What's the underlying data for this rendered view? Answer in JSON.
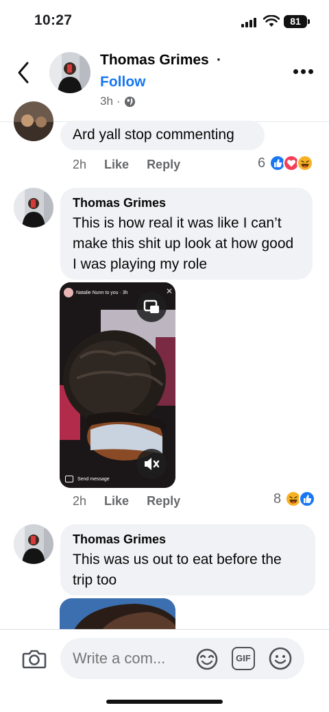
{
  "status_bar": {
    "time": "10:27",
    "battery": "81"
  },
  "post_header": {
    "author_name": "Thomas Grimes",
    "separator": "·",
    "follow_label": "Follow",
    "timestamp": "3h",
    "meta_separator": "·",
    "privacy_icon": "globe-icon"
  },
  "comments": [
    {
      "text": "Ard yall stop commenting",
      "time": "2h",
      "like_label": "Like",
      "reply_label": "Reply",
      "reaction_count": "6",
      "reactions": [
        "like",
        "love",
        "haha"
      ]
    },
    {
      "author": "Thomas Grimes",
      "text": "This is how real it was like I can’t make this shit up look at how good I was playing my role",
      "time": "2h",
      "like_label": "Like",
      "reply_label": "Reply",
      "reaction_count": "8",
      "reactions": [
        "haha",
        "like"
      ],
      "attachment": {
        "type": "video",
        "story_header": "Natalie Nunn to you · 3h",
        "send_message": "Send message"
      }
    },
    {
      "author": "Thomas Grimes",
      "text": "This was us out to eat before the trip too"
    }
  ],
  "composer": {
    "placeholder": "Write a com...",
    "gif_label": "GIF"
  },
  "colors": {
    "accent": "#1877f2",
    "bubble": "#f0f2f5",
    "secondary_text": "#65676b",
    "love": "#f33e58",
    "haha": "#f7b125"
  }
}
